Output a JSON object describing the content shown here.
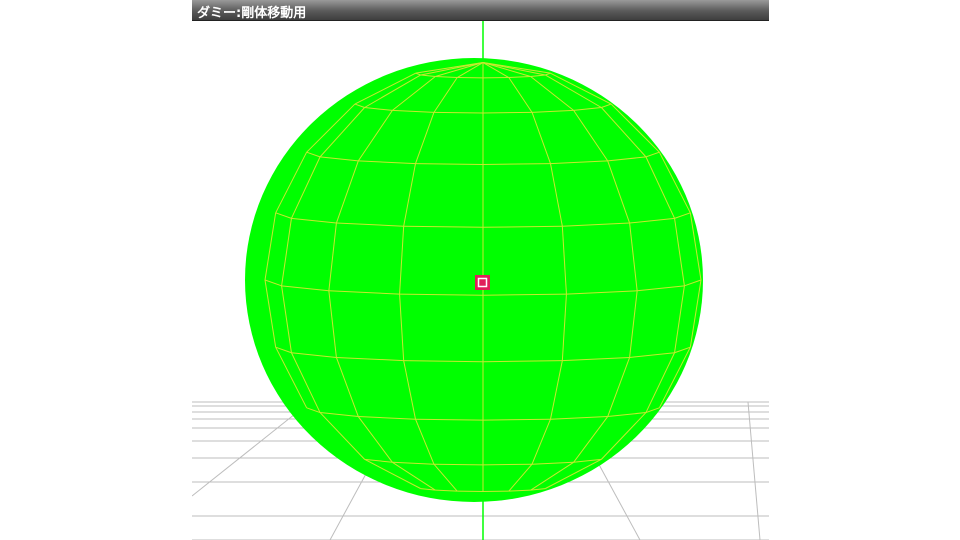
{
  "viewport": {
    "title": "ダミー:剛体移動用",
    "background_color": "#ffffff"
  },
  "scene": {
    "sphere_fill_color": "#00ff00",
    "wireframe_color": "#c8e830",
    "axis_color": "#00ff00",
    "grid_color": "#bdbdbd",
    "selection_marker_color": "#e0205a"
  }
}
